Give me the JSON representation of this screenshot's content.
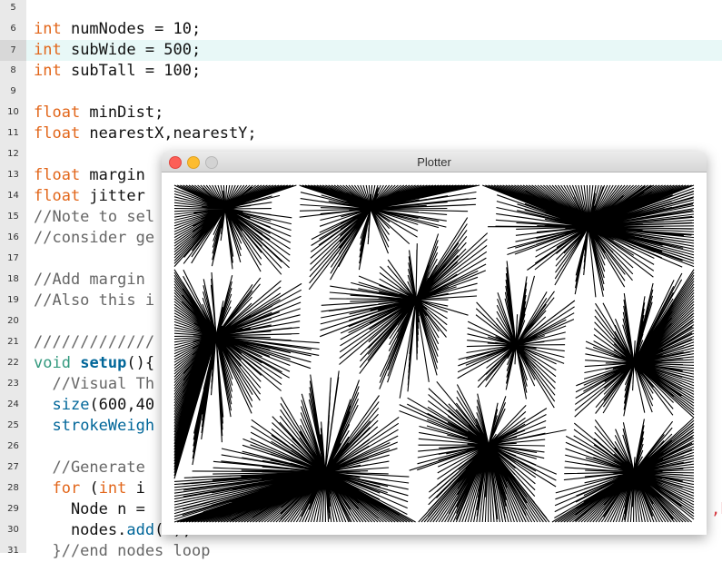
{
  "editor": {
    "lines": [
      {
        "num": "5",
        "segments": []
      },
      {
        "num": "6",
        "segments": [
          {
            "t": "int",
            "c": "kw"
          },
          {
            "t": " numNodes = 10;",
            "c": ""
          }
        ]
      },
      {
        "num": "7",
        "segments": [
          {
            "t": "int",
            "c": "kw"
          },
          {
            "t": " subWide = 500;",
            "c": ""
          }
        ],
        "current": true
      },
      {
        "num": "8",
        "segments": [
          {
            "t": "int",
            "c": "kw"
          },
          {
            "t": " subTall = 100;",
            "c": ""
          }
        ]
      },
      {
        "num": "9",
        "segments": []
      },
      {
        "num": "10",
        "segments": [
          {
            "t": "float",
            "c": "kw"
          },
          {
            "t": " minDist;",
            "c": ""
          }
        ]
      },
      {
        "num": "11",
        "segments": [
          {
            "t": "float",
            "c": "kw"
          },
          {
            "t": " nearestX,nearestY;",
            "c": ""
          }
        ]
      },
      {
        "num": "12",
        "segments": []
      },
      {
        "num": "13",
        "segments": [
          {
            "t": "float",
            "c": "kw"
          },
          {
            "t": " margin",
            "c": ""
          }
        ]
      },
      {
        "num": "14",
        "segments": [
          {
            "t": "float",
            "c": "kw"
          },
          {
            "t": " jitter",
            "c": ""
          }
        ]
      },
      {
        "num": "15",
        "segments": [
          {
            "t": "//Note to sel",
            "c": "cm"
          }
        ]
      },
      {
        "num": "16",
        "segments": [
          {
            "t": "//consider ge",
            "c": "cm"
          }
        ]
      },
      {
        "num": "17",
        "segments": []
      },
      {
        "num": "18",
        "segments": [
          {
            "t": "//Add margin",
            "c": "cm"
          }
        ]
      },
      {
        "num": "19",
        "segments": [
          {
            "t": "//Also this i",
            "c": "cm"
          }
        ]
      },
      {
        "num": "20",
        "segments": []
      },
      {
        "num": "21",
        "segments": [
          {
            "t": "/////////////",
            "c": "cm"
          }
        ]
      },
      {
        "num": "22",
        "segments": [
          {
            "t": "void",
            "c": "kw2"
          },
          {
            "t": " ",
            "c": ""
          },
          {
            "t": "setup",
            "c": "fn"
          },
          {
            "t": "(){",
            "c": ""
          }
        ]
      },
      {
        "num": "23",
        "segments": [
          {
            "t": "  //Visual Th",
            "c": "cm"
          }
        ]
      },
      {
        "num": "24",
        "segments": [
          {
            "t": "  ",
            "c": ""
          },
          {
            "t": "size",
            "c": "fn2"
          },
          {
            "t": "(600,40",
            "c": ""
          }
        ]
      },
      {
        "num": "25",
        "segments": [
          {
            "t": "  ",
            "c": ""
          },
          {
            "t": "strokeWeigh",
            "c": "fn2"
          }
        ]
      },
      {
        "num": "26",
        "segments": []
      },
      {
        "num": "27",
        "segments": [
          {
            "t": "  //Generate",
            "c": "cm"
          }
        ]
      },
      {
        "num": "28",
        "segments": [
          {
            "t": "  ",
            "c": ""
          },
          {
            "t": "for",
            "c": "kw"
          },
          {
            "t": " (",
            "c": ""
          },
          {
            "t": "int",
            "c": "kw"
          },
          {
            "t": " i",
            "c": ""
          }
        ]
      },
      {
        "num": "29",
        "segments": [
          {
            "t": "    Node n =",
            "c": ""
          }
        ]
      },
      {
        "num": "30",
        "segments": [
          {
            "t": "    nodes.",
            "c": ""
          },
          {
            "t": "add",
            "c": "fn2"
          },
          {
            "t": "(n);",
            "c": ""
          }
        ]
      },
      {
        "num": "31",
        "segments": [
          {
            "t": "  }//end nodes loop",
            "c": "cm"
          }
        ]
      }
    ],
    "overflow_text": ",h"
  },
  "plotter": {
    "title": "Plotter",
    "buttons": {
      "close": "close",
      "minimize": "minimize",
      "zoom": "zoom"
    }
  },
  "colors": {
    "keyword": "#e2661a",
    "type": "#33997e",
    "function": "#006699",
    "comment": "#666666",
    "current_line": "#e8f8f7",
    "gutter": "#e9e9e9"
  }
}
